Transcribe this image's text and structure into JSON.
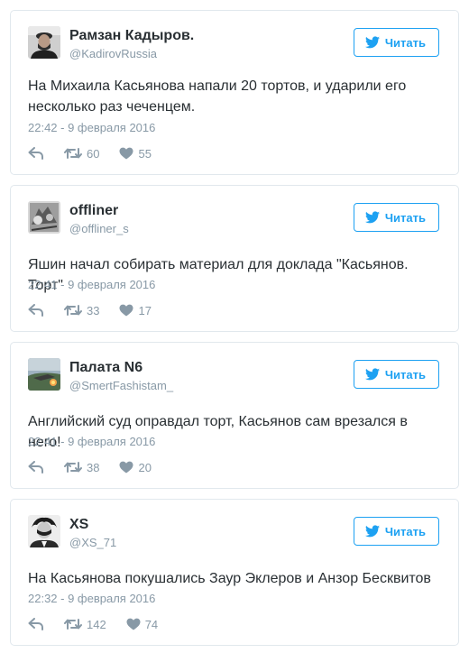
{
  "follow_label": "Читать",
  "colors": {
    "accent": "#1da1f2",
    "muted": "#8899a6",
    "text": "#292f33",
    "border": "#e1e8ed"
  },
  "icons": {
    "reply": "reply-icon",
    "retweet": "retweet-icon",
    "like": "heart-icon",
    "follow": "twitter-bird-icon"
  },
  "tweets": [
    {
      "name": "Рамзан Кадыров.",
      "handle": "@KadirovRussia",
      "text": "На Михаила Касьянова напали 20 тортов, и ударили его несколько раз чеченцем.",
      "time": "22:42 - 9 февраля 2016",
      "retweets": "60",
      "likes": "55"
    },
    {
      "name": "offliner",
      "handle": "@offliner_s",
      "text": "Яшин начал собирать материал для доклада \"Касьянов. Торт\"",
      "time": "22:41 - 9 февраля 2016",
      "retweets": "33",
      "likes": "17"
    },
    {
      "name": "Палата N6",
      "handle": "@SmertFashistam_",
      "text": "Английский суд оправдал торт, Касьянов сам врезался в него!",
      "time": "22:41 - 9 февраля 2016",
      "retweets": "38",
      "likes": "20"
    },
    {
      "name": "XS",
      "handle": "@XS_71",
      "text": "На Касьянова покушались Заур Эклеров и Анзор Бесквитов",
      "time": "22:32 - 9 февраля 2016",
      "retweets": "142",
      "likes": "74"
    }
  ]
}
